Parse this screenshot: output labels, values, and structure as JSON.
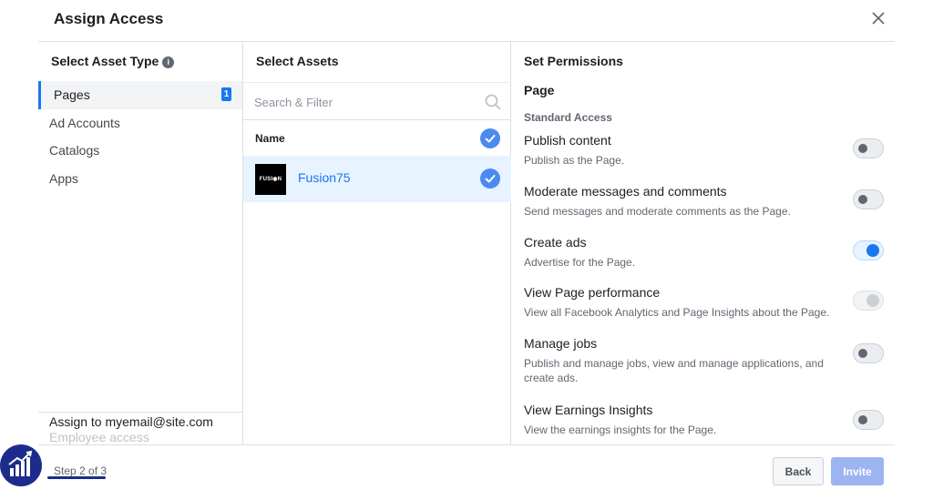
{
  "dialog": {
    "title": "Assign Access",
    "close_icon": "close-icon"
  },
  "asset_types": {
    "heading": "Select Asset Type",
    "info_icon": "info-icon",
    "items": [
      {
        "label": "Pages",
        "count": "1",
        "active": true
      },
      {
        "label": "Ad Accounts"
      },
      {
        "label": "Catalogs"
      },
      {
        "label": "Apps"
      }
    ],
    "assign_to": "Assign to myemail@site.com",
    "assign_subtitle": "Employee access"
  },
  "assets": {
    "heading": "Select Assets",
    "search_placeholder": "Search & Filter",
    "search_icon": "search-icon",
    "name_header": "Name",
    "rows": [
      {
        "thumb_text": "FUSI◉N",
        "name": "Fusion75",
        "selected": true
      }
    ]
  },
  "permissions": {
    "heading": "Set Permissions",
    "subheading": "Page",
    "group": "Standard Access",
    "items": [
      {
        "title": "Publish content",
        "desc": "Publish as the Page.",
        "state": "off"
      },
      {
        "title": "Moderate messages and comments",
        "desc": "Send messages and moderate comments as the Page.",
        "state": "off"
      },
      {
        "title": "Create ads",
        "desc": "Advertise for the Page.",
        "state": "on"
      },
      {
        "title": "View Page performance",
        "desc": "View all Facebook Analytics and Page Insights about the Page.",
        "state": "disabled"
      },
      {
        "title": "Manage jobs",
        "desc": "Publish and manage jobs, view and manage applications, and create ads.",
        "state": "off"
      },
      {
        "title": "View Earnings Insights",
        "desc": "View the earnings insights for the Page.",
        "state": "off"
      }
    ]
  },
  "footer": {
    "step": "Step 2 of 3",
    "back_label": "Back",
    "invite_label": "Invite"
  },
  "colors": {
    "accent": "#1877f2",
    "selected_row": "#e7f3ff",
    "invite_disabled": "#9cb4f0",
    "logo_bg": "#1c2c8c"
  }
}
